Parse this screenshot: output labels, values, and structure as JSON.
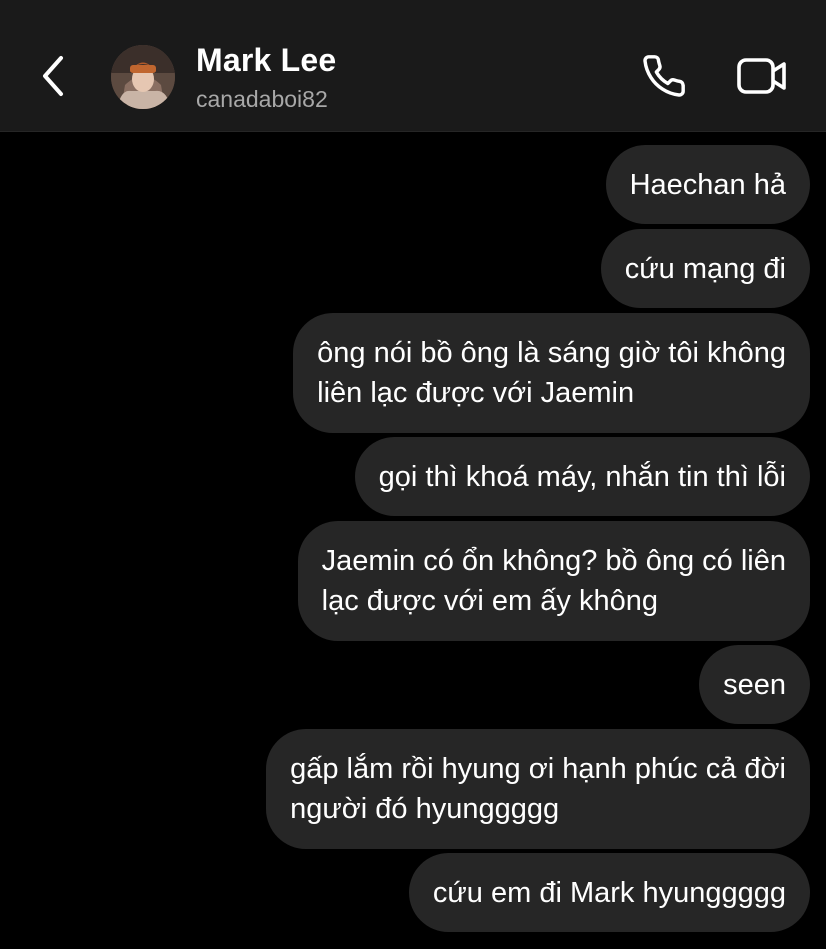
{
  "header": {
    "contact_name": "Mark Lee",
    "contact_username": "canadaboi82",
    "back_icon": "chevron-left-icon",
    "call_icon": "phone-icon",
    "video_icon": "video-camera-icon"
  },
  "messages": [
    {
      "sender": "self",
      "lines": [
        "Haechan hả"
      ]
    },
    {
      "sender": "self",
      "lines": [
        "cứu mạng đi"
      ]
    },
    {
      "sender": "self",
      "lines": [
        "ông nói bồ ông là sáng giờ tôi không",
        "liên lạc được với Jaemin"
      ]
    },
    {
      "sender": "self",
      "lines": [
        "gọi thì khoá máy, nhắn tin thì lỗi"
      ]
    },
    {
      "sender": "self",
      "lines": [
        "Jaemin có ổn không? bồ ông có liên",
        "lạc được với em ấy không"
      ]
    },
    {
      "sender": "self",
      "lines": [
        "seen"
      ]
    },
    {
      "sender": "self",
      "lines": [
        "gấp lắm rồi hyung ơi hạnh phúc cả đời",
        "người đó hyunggggg"
      ]
    },
    {
      "sender": "self",
      "lines": [
        "cứu em đi Mark hyunggggg"
      ]
    }
  ],
  "colors": {
    "background": "#000000",
    "header_background": "#1a1a1a",
    "bubble_background": "#262626",
    "secondary_text": "#a8a8a8"
  }
}
